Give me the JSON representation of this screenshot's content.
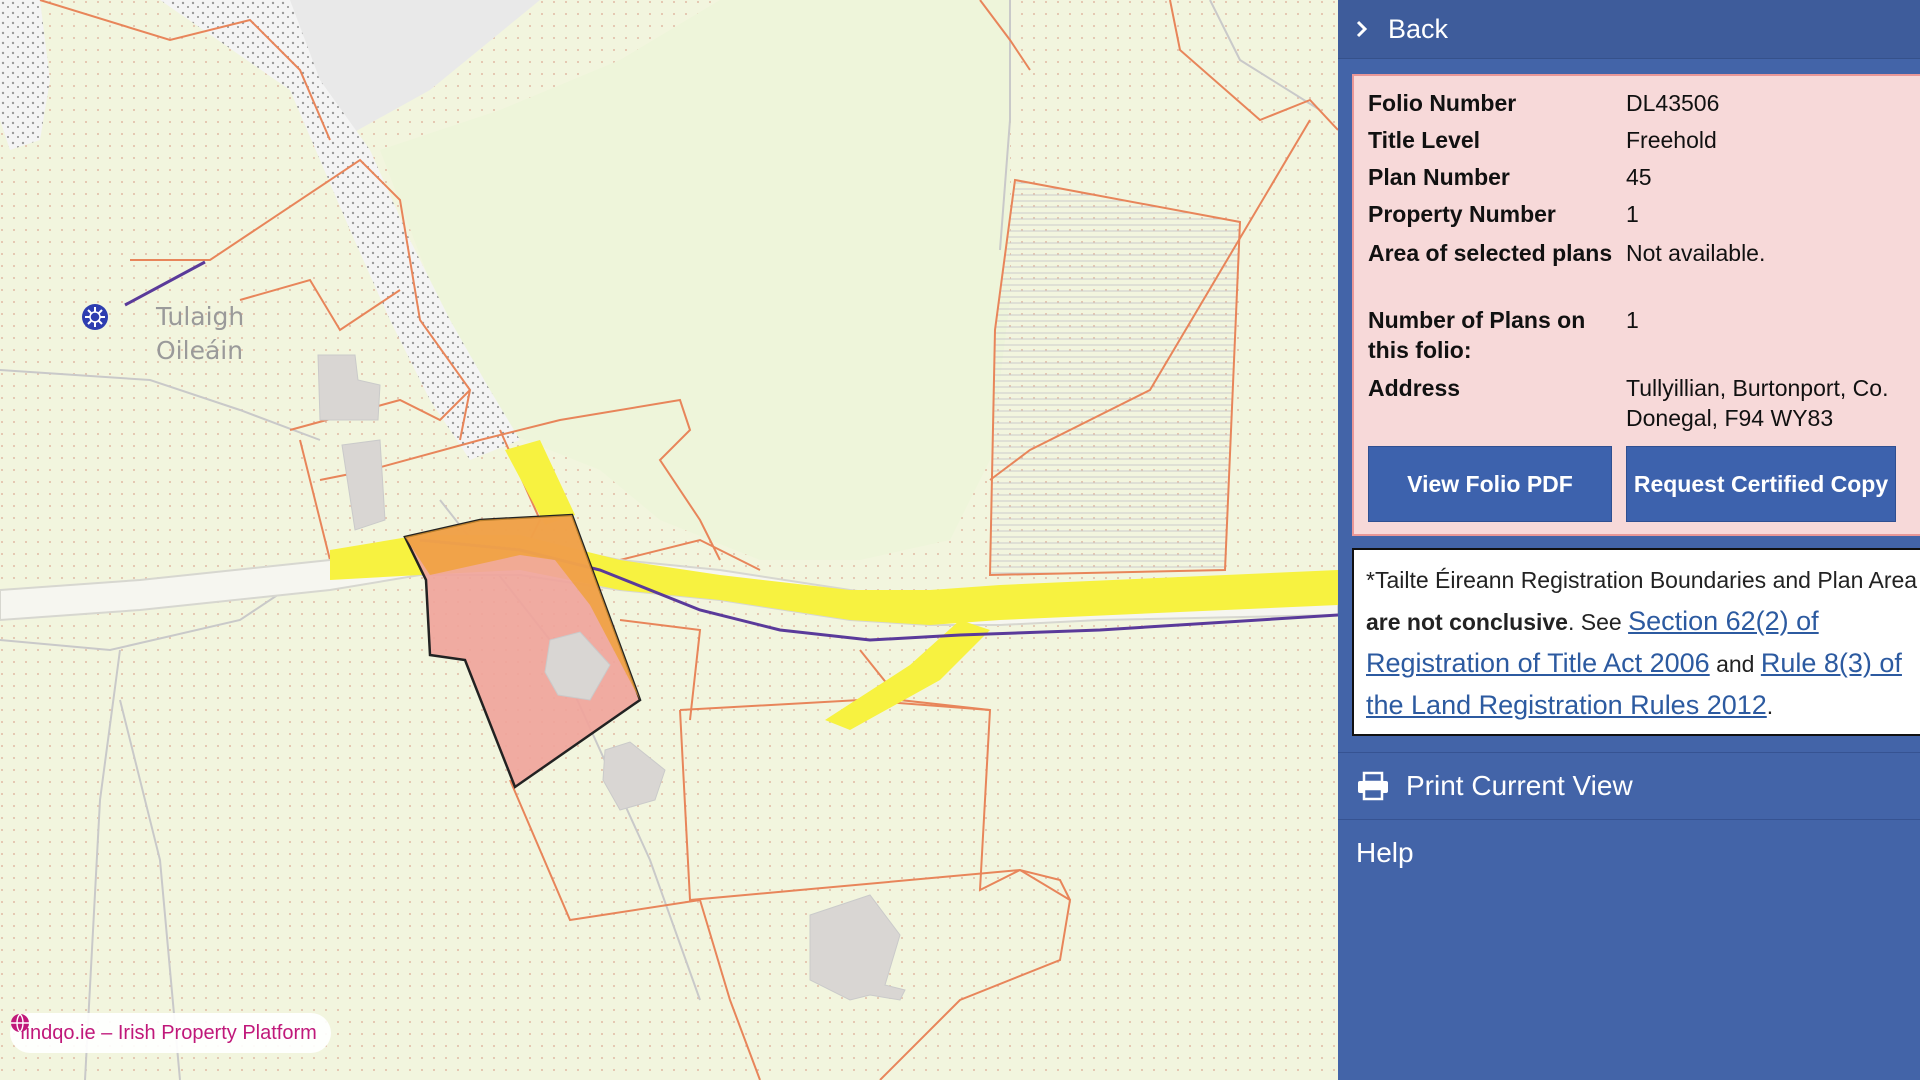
{
  "map": {
    "place_label": "Tulaigh\nOileáin",
    "attribution": "findqo.ie – Irish Property Platform",
    "colors": {
      "land": "#f2f5de",
      "parcel_boundary": "#e8855a",
      "selected_parcel_fill": "#f0a49b",
      "road_fill": "#f7f240",
      "building": "#d9d6d3",
      "water_boundary": "#5a3a9a"
    },
    "icons": [
      "poi-icon",
      "globe-icon"
    ]
  },
  "panel": {
    "back_label": "Back",
    "details": [
      {
        "key": "Folio Number",
        "value": "DL43506"
      },
      {
        "key": "Title Level",
        "value": "Freehold"
      },
      {
        "key": "Plan Number",
        "value": "45"
      },
      {
        "key": "Property Number",
        "value": "1"
      },
      {
        "key": "Area of selected plans",
        "value": "Not available."
      },
      {
        "key": "Number of Plans on this folio:",
        "value": "1"
      },
      {
        "key": "Address",
        "value": "Tullyillian, Burtonport, Co. Donegal, F94 WY83"
      }
    ],
    "buttons": {
      "view_pdf": "View Folio PDF",
      "certified_copy": "Request Certified Copy"
    },
    "notice": {
      "prefix": "*Tailte Éireann Registration Boundaries and Plan Area ",
      "bold": "are not conclusive",
      "middle": ". See ",
      "link1": "Section 62(2) of Registration of Title Act 2006",
      "and": " and ",
      "link2": "Rule 8(3) of the Land Registration Rules 2012",
      "suffix": "."
    },
    "print_label": "Print Current View",
    "help_label": "Help",
    "colors": {
      "panel_bg": "#4364a8",
      "info_bg": "#f7d9d9",
      "info_border": "#e99797",
      "button_bg": "#3d62ad",
      "link": "#2c5aa0"
    }
  }
}
